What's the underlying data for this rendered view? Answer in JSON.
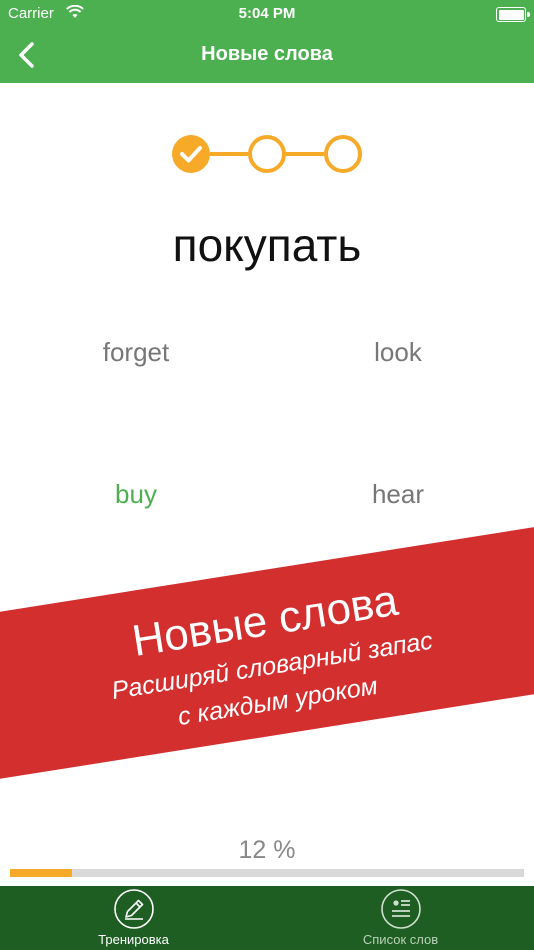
{
  "status_bar": {
    "carrier": "Carrier",
    "time": "5:04 PM"
  },
  "nav": {
    "title": "Новые слова",
    "back_icon": "chevron-left-icon"
  },
  "steps": {
    "completed": 1,
    "total": 3,
    "color": "#f7a928"
  },
  "question": {
    "word": "покупать"
  },
  "options": [
    {
      "label": "forget",
      "state": "default"
    },
    {
      "label": "look",
      "state": "default"
    },
    {
      "label": "buy",
      "state": "correct"
    },
    {
      "label": "hear",
      "state": "default"
    }
  ],
  "banner": {
    "title": "Новые слова",
    "line1": "Расширяй словарный запас",
    "line2": "с каждым уроком",
    "color": "#d32f2f"
  },
  "progress": {
    "label": "12 %",
    "value": 0.12
  },
  "tabs": [
    {
      "label": "Тренировка",
      "icon": "pencil-icon",
      "active": true
    },
    {
      "label": "Список слов",
      "icon": "list-icon",
      "active": false
    }
  ],
  "colors": {
    "primary": "#4caf50",
    "tab_bar": "#1e5e22",
    "accent": "#f7a928"
  }
}
